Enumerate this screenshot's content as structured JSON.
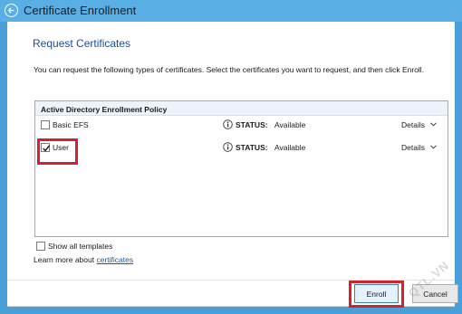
{
  "window": {
    "title": "Certificate Enrollment"
  },
  "page": {
    "heading": "Request Certificates",
    "intro": "You can request the following types of certificates. Select the certificates you want to request, and then click Enroll."
  },
  "policy": {
    "header": "Active Directory Enrollment Policy",
    "rows": [
      {
        "name": "Basic EFS",
        "checked": false,
        "status_label": "STATUS:",
        "status_value": "Available",
        "details": "Details"
      },
      {
        "name": "User",
        "checked": true,
        "status_label": "STATUS:",
        "status_value": "Available",
        "details": "Details"
      }
    ]
  },
  "show_all": {
    "label": "Show all templates",
    "checked": false
  },
  "learn_more": {
    "prefix": "Learn more about ",
    "link": "certificates"
  },
  "buttons": {
    "enroll": "Enroll",
    "cancel": "Cancel"
  },
  "watermark": "QTL.VN",
  "colors": {
    "titlebar": "#59aee4",
    "heading": "#1e4d96",
    "highlight": "#d2232a",
    "link": "#1a5aa8"
  }
}
